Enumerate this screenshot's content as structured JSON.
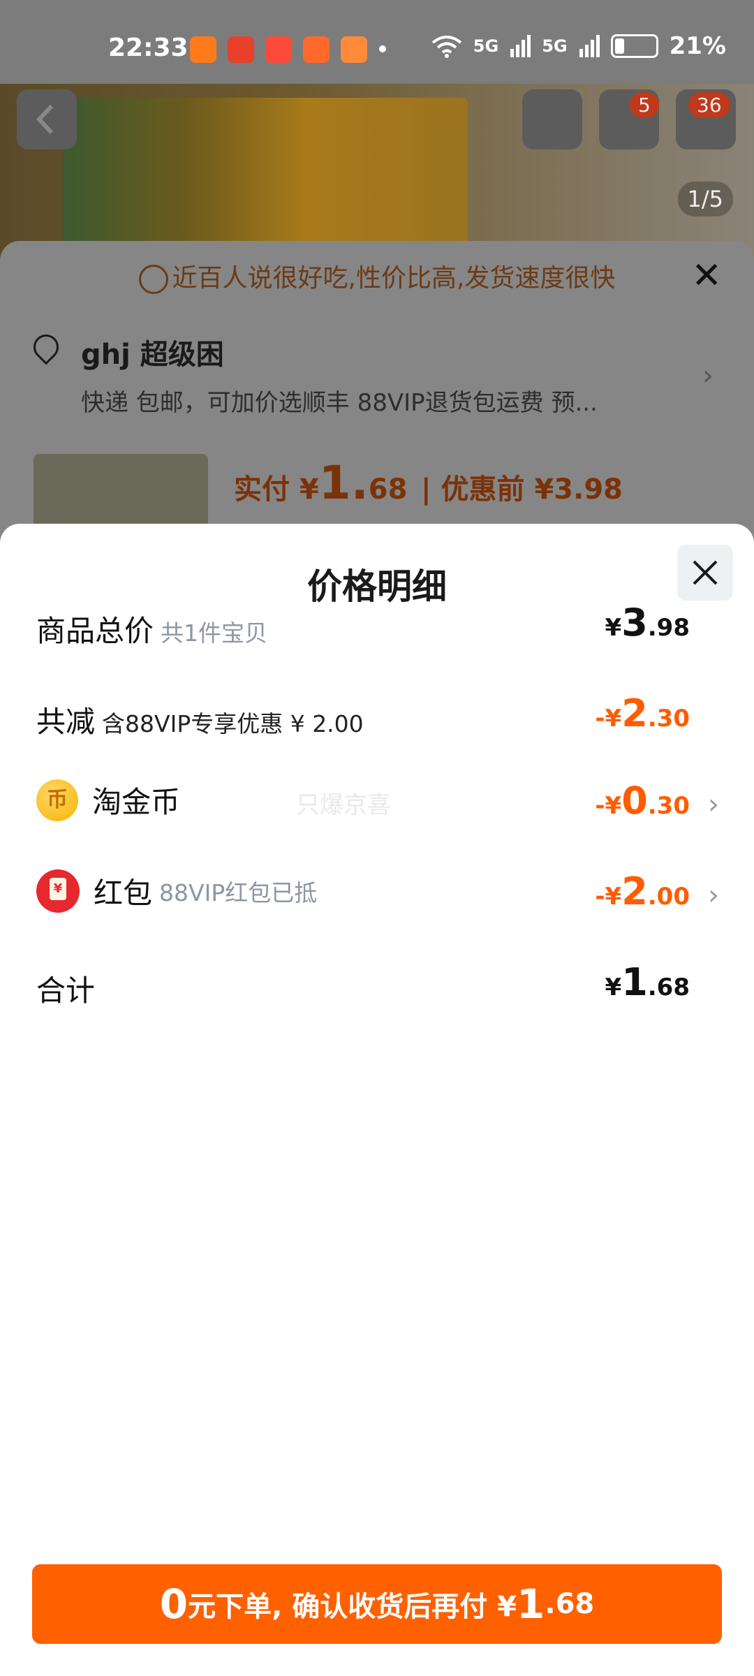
{
  "status_bar": {
    "time": "22:33",
    "signal_1": "5G",
    "signal_2": "5G",
    "battery": "21%",
    "app_icon_colors": [
      "#ff7a1a",
      "#e8402a",
      "#ff4a3a",
      "#ff6a2a",
      "#ff8a3a"
    ]
  },
  "background_page": {
    "cart_badge": "5",
    "more_badge": "36",
    "image_counter": "1/5",
    "banner_text": "近百人说很好吃,性价比高,发货速度很快",
    "address_name": "ghj 超级困",
    "address_detail": "快递 包邮，可加价选顺丰 88VIP退货包运费 预...",
    "price_label": "实付 ¥",
    "price_int": "1.",
    "price_dec": "68",
    "price_before": "| 优惠前 ¥3.98"
  },
  "sheet": {
    "title": "价格明细",
    "rows": [
      {
        "label": "商品总价",
        "sub": "共1件宝贝",
        "yen": "¥",
        "int": "3",
        "dec": ".98"
      },
      {
        "label": "共减",
        "sub": "含88VIP专享优惠 ¥ 2.00",
        "yen": "-¥",
        "int": "2",
        "dec": ".30"
      },
      {
        "label": "淘金币",
        "sub": "",
        "yen": "-¥",
        "int": "0",
        "dec": ".30",
        "icon": "coin-icon"
      },
      {
        "label": "红包",
        "sub": "88VIP红包已抵",
        "yen": "-¥",
        "int": "2",
        "dec": ".00",
        "icon": "red-packet-icon"
      },
      {
        "label": "合计",
        "sub": "",
        "yen": "¥",
        "int": "1",
        "dec": ".68"
      }
    ],
    "coin_glyph": "币",
    "watermark": "只爆京喜"
  },
  "bottom_button": {
    "zero": "0",
    "text": "元下单, 确认收货后再付 ¥",
    "amount_int": "1",
    "amount_dec": ".68"
  },
  "colors": {
    "accent_orange": "#ff6000",
    "discount_orange": "#ff5c00"
  }
}
